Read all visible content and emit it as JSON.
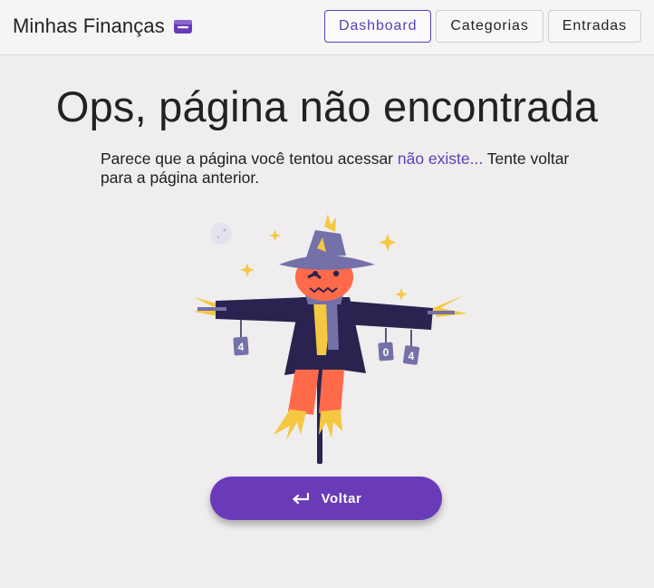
{
  "header": {
    "title": "Minhas Finanças",
    "icon": "wallet-icon",
    "nav": [
      {
        "label": "Dashboard",
        "active": true
      },
      {
        "label": "Categorias",
        "active": false
      },
      {
        "label": "Entradas",
        "active": false
      }
    ]
  },
  "main": {
    "headline": "Ops, página não encontrada",
    "message_before": "Parece que a página você tentou acessar ",
    "message_link": "não existe...",
    "message_after": " Tente voltar para a página anterior.",
    "illustration": {
      "name": "scarecrow-404-illustration",
      "tags": [
        "4",
        "0",
        "4"
      ]
    },
    "back_button": {
      "label": "Voltar",
      "icon": "arrow-back-icon"
    }
  },
  "colors": {
    "accent": "#5b3fb8",
    "button": "#6a3bb8",
    "background": "#efedee",
    "header_bg": "#f5f5f5"
  }
}
